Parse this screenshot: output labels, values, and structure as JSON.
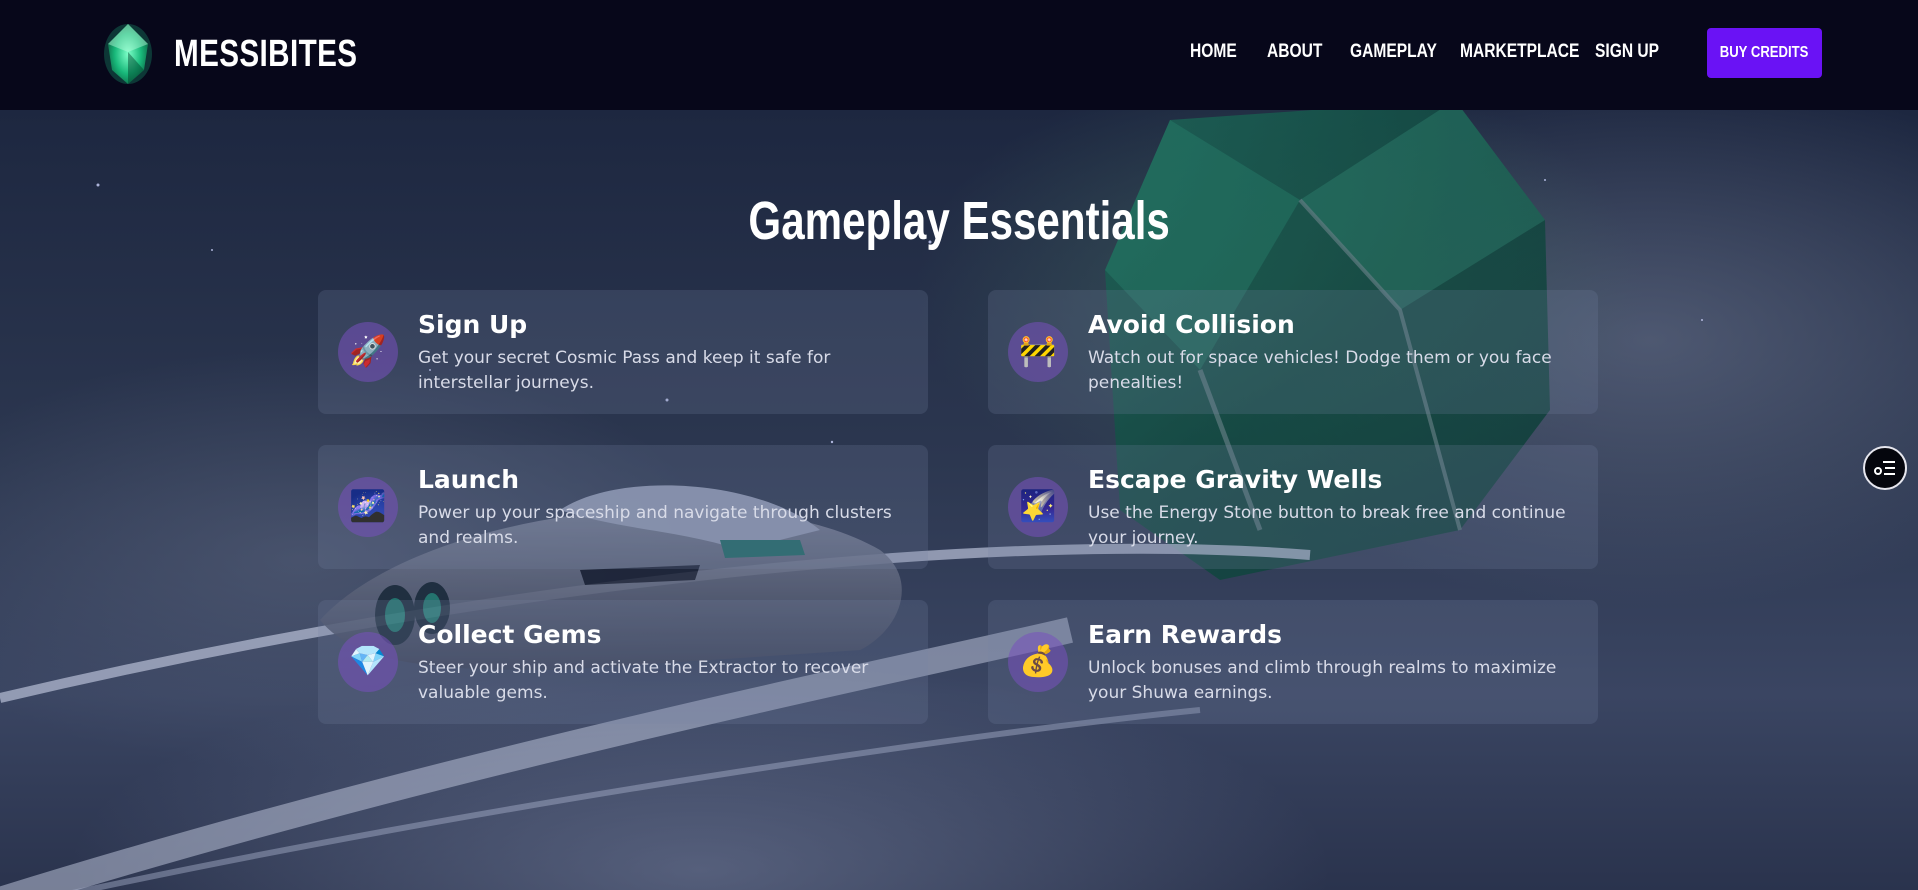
{
  "brand": {
    "name": "MESSIBITES",
    "logo_icon": "emerald-gem-icon",
    "logo_color": "#1fc98a"
  },
  "nav": {
    "links": [
      "HOME",
      "ABOUT",
      "GAMEPLAY",
      "MARKETPLACE",
      "SIGN UP"
    ],
    "cta": "BUY CREDITS",
    "cta_color": "#6a12f5"
  },
  "main": {
    "title": "Gameplay Essentials",
    "cards": [
      {
        "title": "Sign Up",
        "description": "Get your secret Cosmic Pass and keep it safe for interstellar journeys.",
        "icon": "rocket-icon",
        "glyph": "🚀"
      },
      {
        "title": "Avoid Collision",
        "description": "Watch out for space vehicles! Dodge them or you face penealties!",
        "icon": "construction-barrier-icon",
        "glyph": "🚧"
      },
      {
        "title": "Launch",
        "description": "Power up your spaceship and navigate through clusters and realms.",
        "icon": "milky-way-icon",
        "glyph": "🌌"
      },
      {
        "title": "Escape Gravity Wells",
        "description": "Use the Energy Stone button to break free and continue your journey.",
        "icon": "shooting-star-icon",
        "glyph": "🌠"
      },
      {
        "title": "Collect Gems",
        "description": "Steer your ship and activate the Extractor to recover valuable gems.",
        "icon": "gem-stone-icon",
        "glyph": "💎"
      },
      {
        "title": "Earn Rewards",
        "description": "Unlock bonuses and climb through realms to maximize your Shuwa earnings.",
        "icon": "money-bag-icon",
        "glyph": "💰"
      }
    ]
  },
  "floating_button": {
    "icon": "settings-list-icon"
  }
}
